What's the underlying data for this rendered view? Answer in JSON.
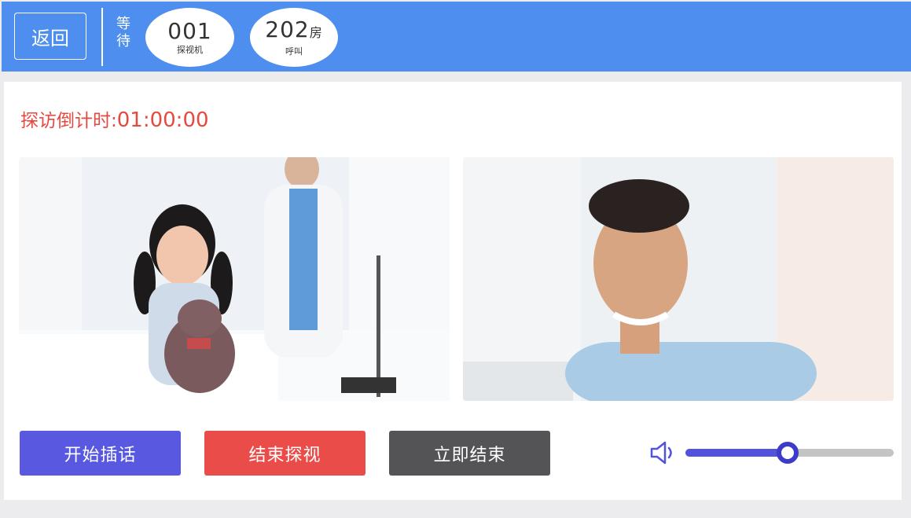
{
  "header": {
    "back_label": "返回",
    "wait_label": "等\n待",
    "terminal": {
      "number": "001",
      "label": "探视机"
    },
    "room": {
      "number": "202",
      "unit": "房",
      "label": "呼叫"
    }
  },
  "countdown": {
    "label": "探访倒计时:",
    "time": "01:00:00"
  },
  "videos": {
    "left_icon": "patient-video-feed",
    "right_icon": "visitor-video-feed"
  },
  "buttons": {
    "interject": "开始插话",
    "end_visit": "结束探视",
    "end_now": "立即结束"
  },
  "volume": {
    "icon": "speaker-icon",
    "level": 0.49
  },
  "colors": {
    "header": "#4d8eee",
    "countdown": "#e5493f",
    "interject": "#5858e0",
    "end_visit": "#ea4c4a",
    "end_now": "#545456",
    "slider_fill": "#5252dc"
  }
}
